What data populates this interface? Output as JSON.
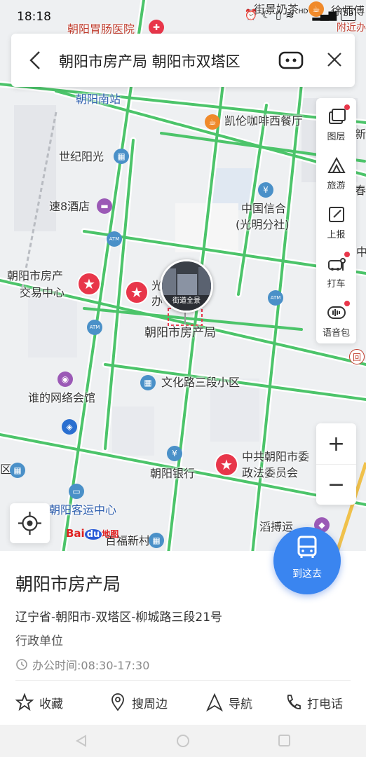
{
  "status_bar": {
    "time": "18:18",
    "icons": [
      "alarm-icon",
      "moon-icon",
      "vibrate-icon",
      "wifi-icon",
      "hd-icon",
      "signal-icon",
      "battery-icon"
    ],
    "hd_text": "HD",
    "battery_level": "59"
  },
  "search": {
    "query": "朝阳市房产局 朝阳市双塔区"
  },
  "toolbar": {
    "items": [
      {
        "label": "图层",
        "icon": "layers-icon",
        "badge": true
      },
      {
        "label": "旅游",
        "icon": "travel-icon",
        "badge": false
      },
      {
        "label": "上报",
        "icon": "report-icon",
        "badge": false
      },
      {
        "label": "打车",
        "icon": "taxi-icon",
        "badge": true
      },
      {
        "label": "语音包",
        "icon": "voice-pack-icon",
        "badge": true
      }
    ]
  },
  "zoom": {
    "in_label": "+",
    "out_label": "−"
  },
  "map": {
    "pois": [
      {
        "label": "朝阳胃肠医院",
        "style": "red"
      },
      {
        "label": "街景奶茶"
      },
      {
        "label": "徐师傅"
      },
      {
        "label": "附近办"
      },
      {
        "label": "朝阳南站",
        "style": "blue"
      },
      {
        "label": "凯伦咖啡西餐厅"
      },
      {
        "label": "世纪阳光"
      },
      {
        "label": "速8酒店"
      },
      {
        "label": "中国信合"
      },
      {
        "label": "(光明分社)"
      },
      {
        "label": "朝阳市房产"
      },
      {
        "label": "交易中心"
      },
      {
        "label": "光"
      },
      {
        "label": "办"
      },
      {
        "label": "朝阳市房产局"
      },
      {
        "label": "文化路三段小区"
      },
      {
        "label": "谁的网络会馆"
      },
      {
        "label": "朝阳银行"
      },
      {
        "label": "中共朝阳市委"
      },
      {
        "label": "政法委员会"
      },
      {
        "label": "朝阳客运中心",
        "style": "blue"
      },
      {
        "label": "百福新村"
      },
      {
        "label": "滔搏运"
      },
      {
        "label": "新"
      },
      {
        "label": "春"
      },
      {
        "label": "中"
      },
      {
        "label": "区"
      }
    ],
    "atm_label": "ATM",
    "street_view_label": "街道全景",
    "logo_text": "Bai",
    "logo_du": "du",
    "logo_suffix": "地图"
  },
  "go_button": {
    "label": "到这去"
  },
  "place": {
    "name": "朝阳市房产局",
    "address": "辽宁省-朝阳市-双塔区-柳城路三段21号",
    "category": "行政单位",
    "hours": "办公时间:08:30-17:30"
  },
  "actions": [
    {
      "label": "收藏",
      "icon": "star-outline-icon"
    },
    {
      "label": "搜周边",
      "icon": "location-pin-icon"
    },
    {
      "label": "导航",
      "icon": "navigation-arrow-icon"
    },
    {
      "label": "打电话",
      "icon": "phone-icon"
    }
  ],
  "colors": {
    "road": "#4cc46a",
    "accent": "#3a85f0",
    "pin_red": "#e8364a",
    "poi_blue": "#2f7ec9"
  }
}
